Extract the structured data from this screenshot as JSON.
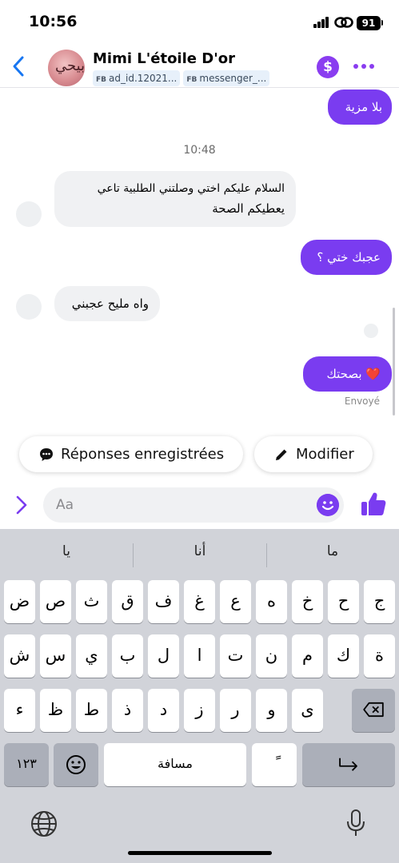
{
  "status_bar": {
    "time": "10:56",
    "battery": "91"
  },
  "header": {
    "name": "Mimi L'étoile D'or",
    "avatar_text": "ابيحي",
    "tags": [
      {
        "prefix": "FB",
        "text": "ad_id.12021..."
      },
      {
        "prefix": "FB",
        "text": "messenger_..."
      }
    ],
    "payment_symbol": "$"
  },
  "messages": {
    "out_1": "بلا مزية",
    "timestamp": "10:48",
    "in_1_line1": "السلام عليكم  اختي وصلتني الطلبية تاعي",
    "in_1_line2": "يعطيكم الصحة",
    "out_2": "عجبك ختي ؟",
    "in_2": "واه مليح عجبني",
    "out_3": "بصحتك ❤️",
    "status": "Envoyé"
  },
  "quick_replies": {
    "saved": "Réponses enregistrées",
    "edit": "Modifier"
  },
  "composer": {
    "placeholder": "Aa"
  },
  "keyboard": {
    "suggestions": [
      "ما",
      "أنا",
      "يا"
    ],
    "row1": [
      "ج",
      "ح",
      "خ",
      "ه",
      "ع",
      "غ",
      "ف",
      "ق",
      "ث",
      "ص",
      "ض"
    ],
    "row2": [
      "ة",
      "ك",
      "م",
      "ن",
      "ت",
      "ا",
      "ل",
      "ب",
      "ي",
      "س",
      "ش"
    ],
    "row3": [
      "ى",
      "و",
      "ر",
      "ز",
      "د",
      "ذ",
      "ط",
      "ظ",
      "ء"
    ],
    "numbers_key": "١٢٣",
    "space_key": "مسافة",
    "diacritic_key": "ً"
  },
  "colors": {
    "accent": "#7a3cf0",
    "incoming_bubble": "#f0f1f3",
    "keyboard_bg": "#d1d3d9"
  }
}
